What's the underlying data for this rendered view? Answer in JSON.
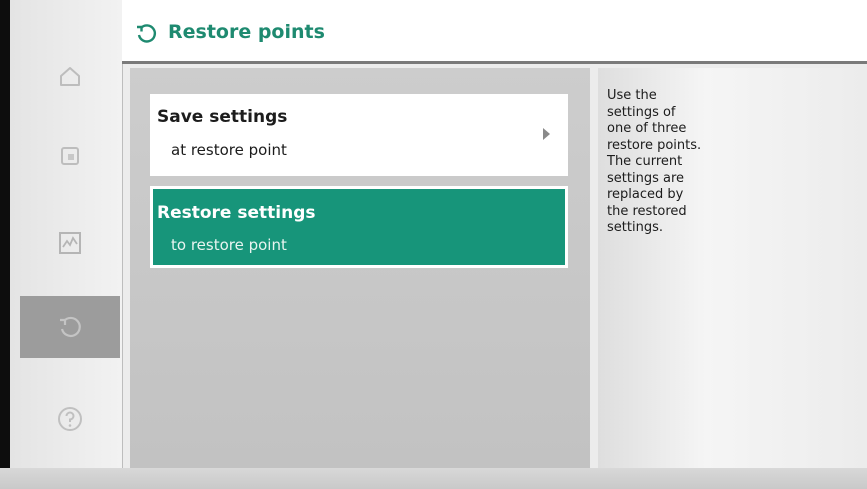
{
  "header": {
    "title": "Restore points",
    "icon": "restore-icon"
  },
  "sidebar": {
    "items": [
      {
        "id": "home",
        "icon": "home-icon",
        "active": false
      },
      {
        "id": "settings",
        "icon": "settings-icon",
        "active": false
      },
      {
        "id": "diagnostics",
        "icon": "diagnostics-icon",
        "active": false
      },
      {
        "id": "restore",
        "icon": "restore-icon",
        "active": true
      },
      {
        "id": "help",
        "icon": "help-icon",
        "active": false
      }
    ]
  },
  "menu": {
    "items": [
      {
        "title": "Save settings",
        "subtitle": "at restore point",
        "selected": false,
        "has_submenu": true
      },
      {
        "title": "Restore settings",
        "subtitle": "to restore point",
        "selected": true,
        "has_submenu": false
      }
    ]
  },
  "info_panel": {
    "text": "Use the\nsettings of\none of three\nrestore points.\nThe current\nsettings are\nreplaced by\nthe restored\nsettings."
  },
  "colors": {
    "accent": "#17957a",
    "title": "#1e8a70",
    "active_nav": "#9c9c9c"
  }
}
